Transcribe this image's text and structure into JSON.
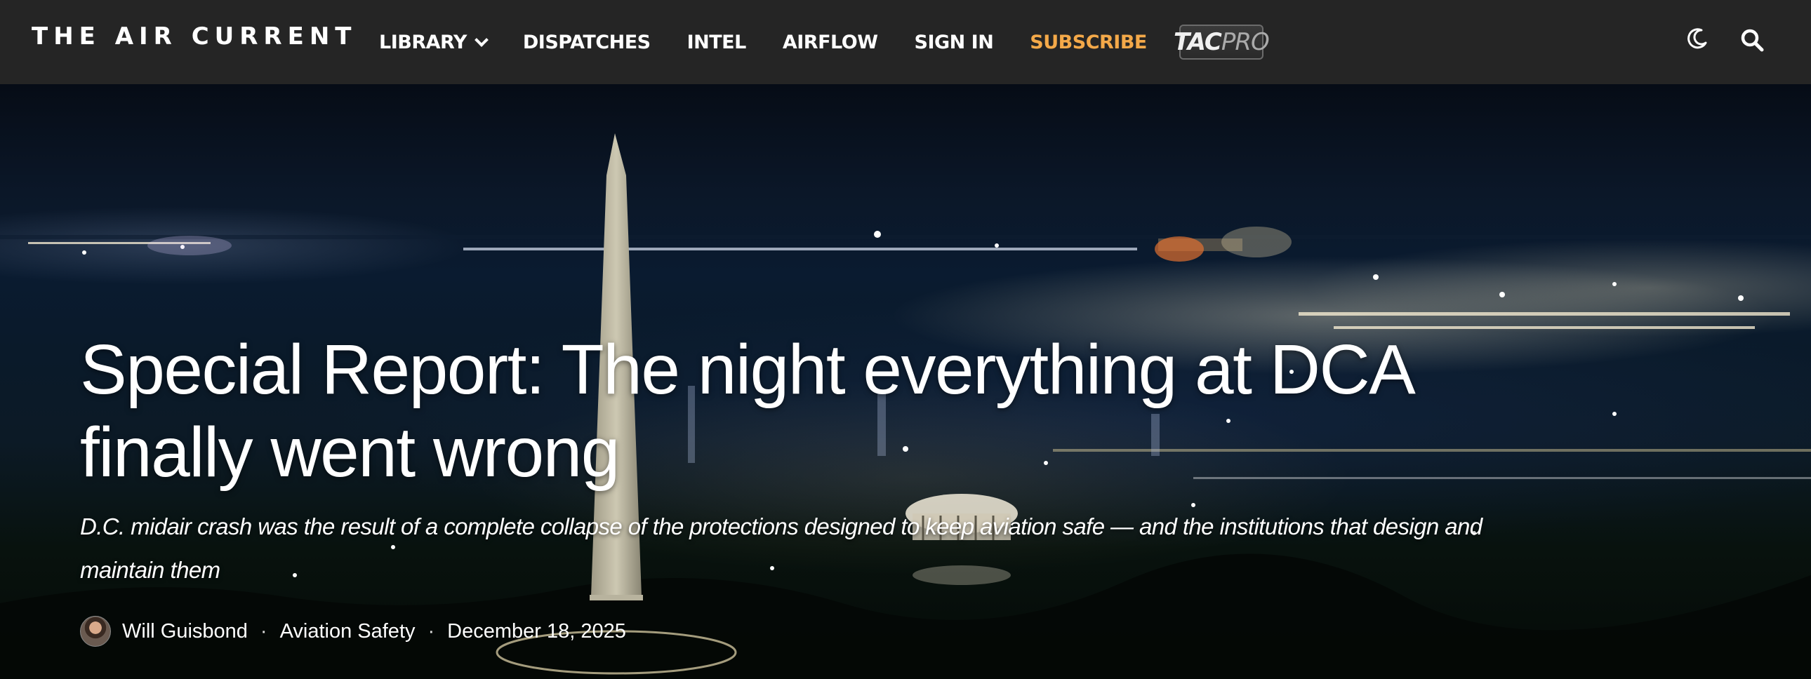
{
  "nav": {
    "logo": "THE AIR CURRENT",
    "links": [
      {
        "label": "LIBRARY",
        "has_dropdown": true
      },
      {
        "label": "DISPATCHES"
      },
      {
        "label": "INTEL"
      },
      {
        "label": "AIRFLOW"
      },
      {
        "label": "SIGN IN"
      },
      {
        "label": "SUBSCRIBE",
        "color": "#f4a949"
      }
    ],
    "tacpro": {
      "tac": "TAC",
      "pro": "PRO"
    },
    "icons": [
      "moon-icon",
      "search-icon"
    ]
  },
  "article": {
    "headline": "Special Report: The night everything at DCA finally went wrong",
    "dek": "D.C. midair crash was the result of a complete collapse of the protections designed to keep aviation safe — and the institutions that design and maintain them",
    "author": "Will Guisbond",
    "category": "Aviation Safety",
    "date": "December 18, 2025",
    "separator": "·"
  },
  "colors": {
    "nav_bg": "#252525",
    "accent": "#f4a949",
    "text": "#ffffff"
  }
}
